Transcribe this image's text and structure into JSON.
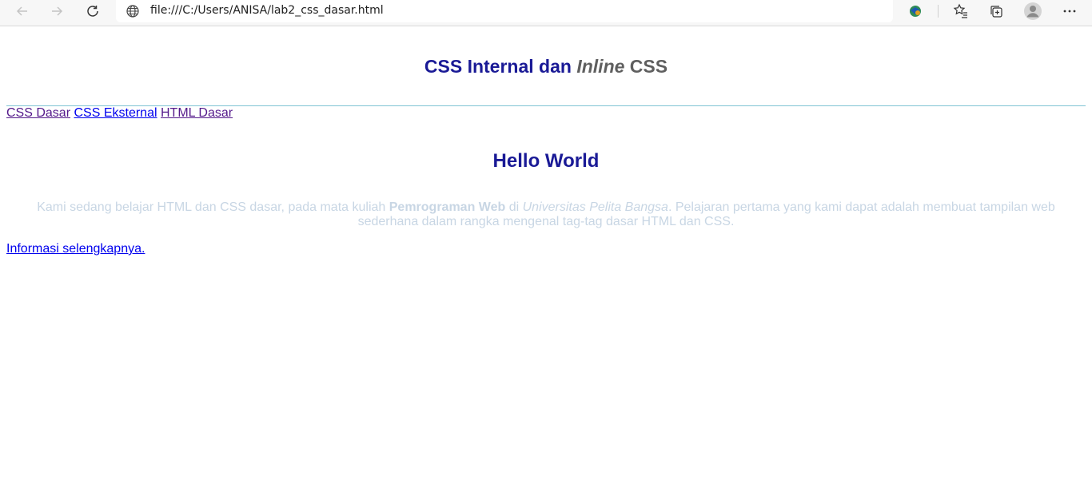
{
  "browser": {
    "url": "file:///C:/Users/ANISA/lab2_css_dasar.html"
  },
  "heading": {
    "part1": "CSS Internal dan ",
    "italic": "Inline",
    "part2": " CSS"
  },
  "nav": {
    "link1": "CSS Dasar",
    "link2": "CSS Eksternal",
    "link3": "HTML Dasar"
  },
  "subheading": "Hello World",
  "paragraph": {
    "text1": "Kami sedang belajar HTML dan CSS dasar, pada mata kuliah ",
    "bold": "Pemrograman Web",
    "text2": " di ",
    "italic": "Universitas Pelita Bangsa",
    "text3": ". Pelajaran pertama yang kami dapat adalah membuat tampilan web sederhana dalam rangka mengenal tag-tag dasar HTML dan CSS."
  },
  "more_link": "Informasi selengkapnya.",
  "colors": {
    "heading": "#1a1a96",
    "accent_gray": "#5f5f5f",
    "paragraph": "#c8d6e4",
    "rule": "#7fc4d4"
  }
}
